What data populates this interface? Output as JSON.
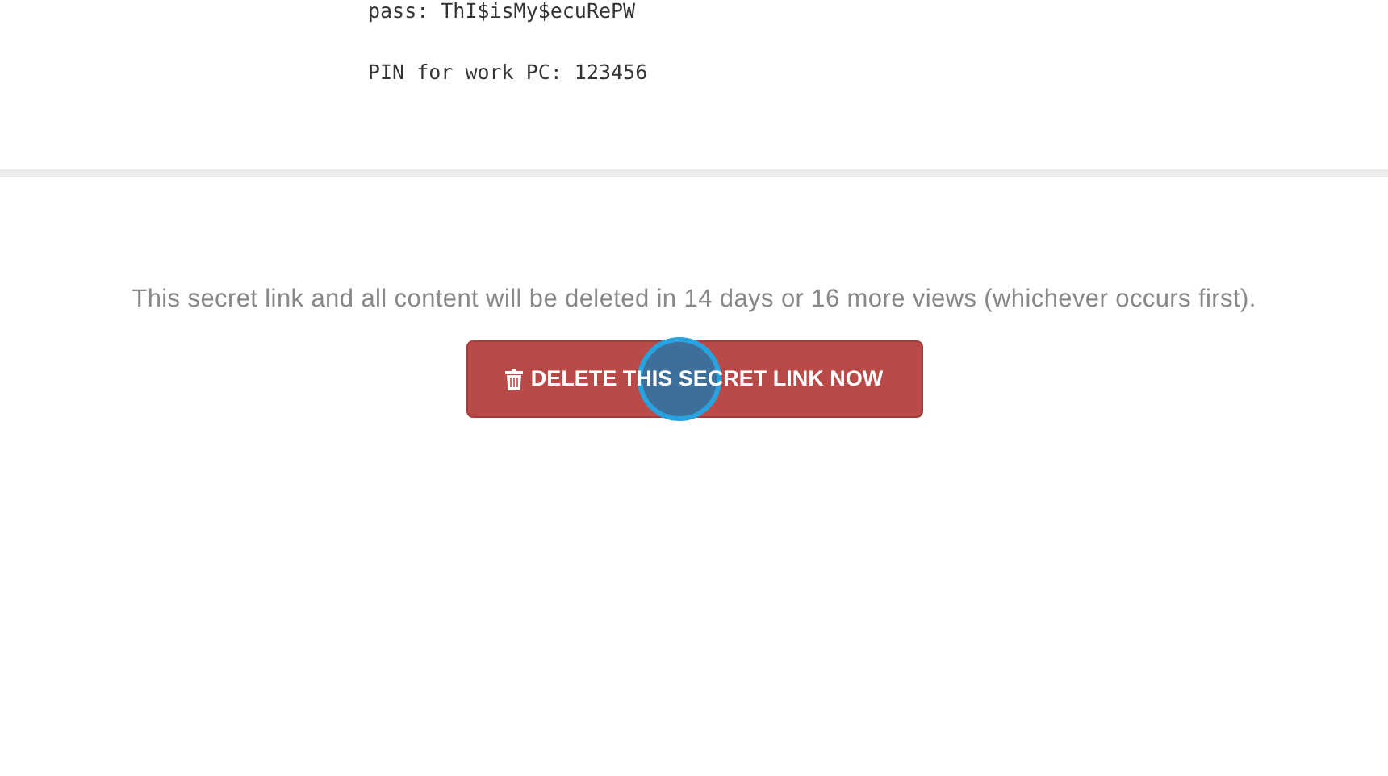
{
  "secret_lines": [
    "pass: ThI$isMy$ecuRePW",
    "PIN for work PC: 123456"
  ],
  "notice": "This secret link and all content will be deleted in 14 days or 16 more views (whichever occurs first).",
  "delete_button": {
    "label": "DELETE THIS SECRET LINK NOW"
  }
}
